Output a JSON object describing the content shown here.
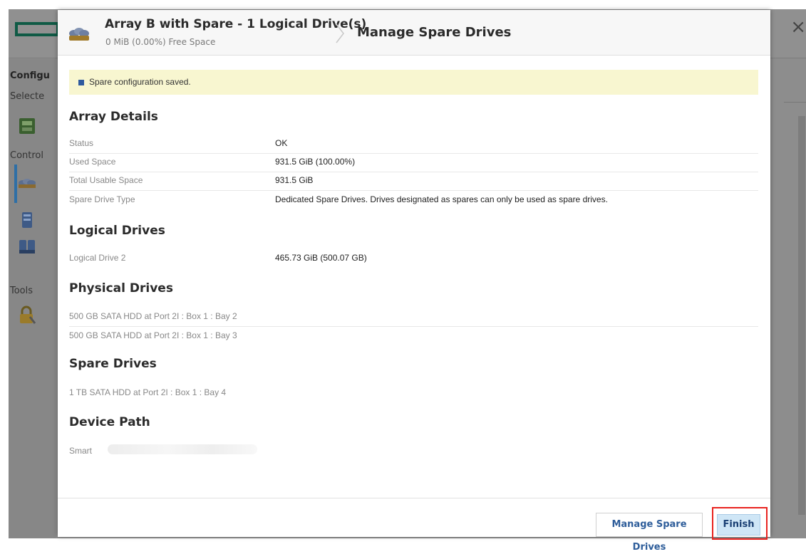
{
  "window": {
    "close_glyph": "×"
  },
  "background": {
    "sidebar": {
      "configure_label": "Configu",
      "selected_label": "Selecte",
      "controller_label": "Control",
      "tools_label": "Tools"
    }
  },
  "dialog": {
    "array_title": "Array B with Spare - 1 Logical Drive(s)",
    "array_subtitle": "0 MiB (0.00%) Free Space",
    "page_title": "Manage Spare Drives",
    "notice": "Spare configuration saved.",
    "sections": {
      "array_details": {
        "heading": "Array Details",
        "rows": [
          {
            "key": "Status",
            "value": "OK"
          },
          {
            "key": "Used Space",
            "value": "931.5 GiB (100.00%)"
          },
          {
            "key": "Total Usable Space",
            "value": "931.5 GiB"
          },
          {
            "key": "Spare Drive Type",
            "value": "Dedicated Spare Drives. Drives designated as spares can only be used as spare drives."
          }
        ]
      },
      "logical_drives": {
        "heading": "Logical Drives",
        "rows": [
          {
            "key": "Logical Drive 2",
            "value": "465.73 GiB (500.07 GB)"
          }
        ]
      },
      "physical_drives": {
        "heading": "Physical Drives",
        "rows": [
          {
            "key": "500 GB SATA HDD at Port 2I : Box 1 : Bay 2"
          },
          {
            "key": "500 GB SATA HDD at Port 2I : Box 1 : Bay 3"
          }
        ]
      },
      "spare_drives": {
        "heading": "Spare Drives",
        "rows": [
          {
            "key": "1 TB SATA HDD at Port 2I : Box 1 : Bay 4"
          }
        ]
      },
      "device_path": {
        "heading": "Device Path",
        "value": "Smart"
      }
    },
    "footer": {
      "manage_button": "Manage Spare Drives",
      "finish_button": "Finish"
    }
  },
  "colors": {
    "accent": "#2e5d9a",
    "notice_bg": "#f8f6d0",
    "highlight": "#e8231f",
    "hpe_green": "#0f5a45"
  }
}
